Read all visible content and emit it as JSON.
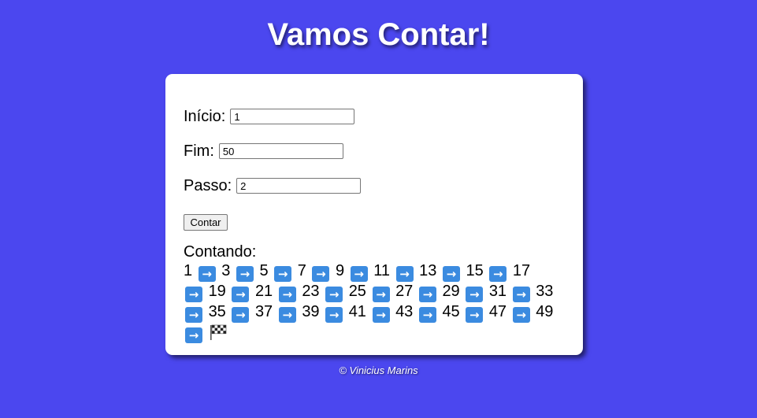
{
  "header": {
    "title": "Vamos Contar!"
  },
  "form": {
    "start": {
      "label": "Início:",
      "value": "1"
    },
    "end": {
      "label": "Fim:",
      "value": "50"
    },
    "step": {
      "label": "Passo:",
      "value": "2"
    },
    "submit_label": "Contar"
  },
  "result": {
    "label": "Contando:",
    "numbers": [
      "1",
      "3",
      "5",
      "7",
      "9",
      "11",
      "13",
      "15",
      "17",
      "19",
      "21",
      "23",
      "25",
      "27",
      "29",
      "31",
      "33",
      "35",
      "37",
      "39",
      "41",
      "43",
      "45",
      "47",
      "49"
    ],
    "separator_icon": "right-arrow-emoji-icon",
    "end_icon": "checkered-flag-icon"
  },
  "footer": {
    "text": "© Vinicius Marins"
  },
  "colors": {
    "background": "#4b47ef",
    "card": "#ffffff",
    "arrow": "#3b8be0"
  }
}
